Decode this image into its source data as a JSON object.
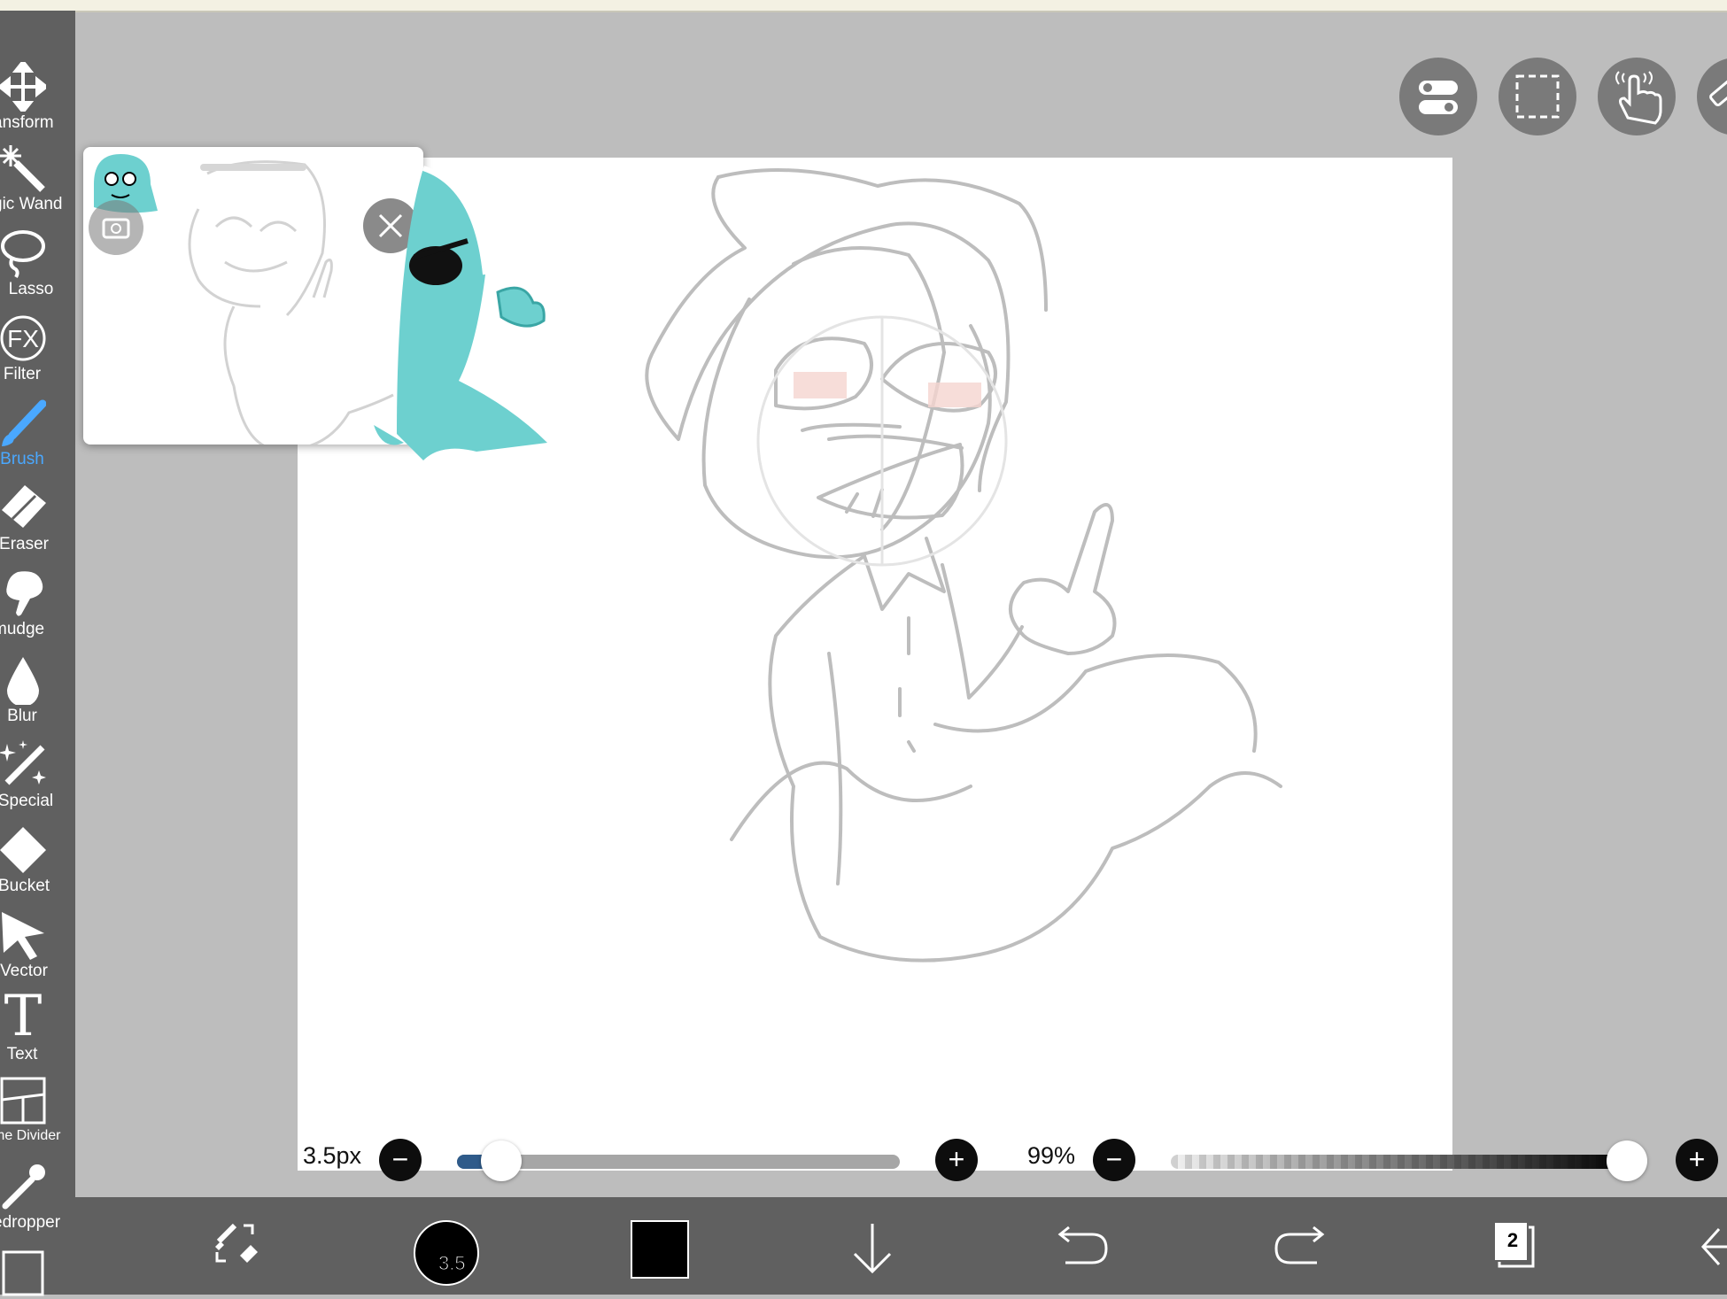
{
  "toolbar": {
    "tools": [
      {
        "label": "ansform",
        "icon": "transform-icon"
      },
      {
        "label": "gic Wand",
        "icon": "magic-wand-icon"
      },
      {
        "label": "Lasso",
        "icon": "lasso-icon"
      },
      {
        "label": "Filter",
        "icon": "filter-fx-icon",
        "fx": "FX"
      },
      {
        "label": "Brush",
        "icon": "brush-icon",
        "active": true
      },
      {
        "label": "Eraser",
        "icon": "eraser-icon"
      },
      {
        "label": "mudge",
        "icon": "smudge-icon"
      },
      {
        "label": "Blur",
        "icon": "blur-drop-icon"
      },
      {
        "label": "Special",
        "icon": "special-pen-icon"
      },
      {
        "label": "Bucket",
        "icon": "bucket-icon"
      },
      {
        "label": "Vector",
        "icon": "vector-arrow-icon"
      },
      {
        "label": "Text",
        "icon": "text-icon",
        "glyph": "T"
      },
      {
        "label": "me Divider",
        "icon": "frame-divider-icon"
      },
      {
        "label": "edropper",
        "icon": "eyedropper-icon"
      }
    ]
  },
  "top_buttons": [
    {
      "name": "toggle-icon"
    },
    {
      "name": "selection-icon"
    },
    {
      "name": "gesture-hand-icon"
    },
    {
      "name": "ruler-icon"
    }
  ],
  "sliders": {
    "brush_size": {
      "label": "3.5px",
      "value_fraction": 0.03
    },
    "opacity": {
      "label": "99%",
      "value_fraction": 0.99
    }
  },
  "bottom_bar": {
    "brush_size_badge": "3.5",
    "color": "#000000",
    "layers_count": "2",
    "icons": [
      "brush-swap-icon",
      "brush-size-icon",
      "color-swatch-icon",
      "download-arrow-icon",
      "undo-icon",
      "redo-icon",
      "layers-icon",
      "back-icon"
    ]
  },
  "colors": {
    "accent": "#4aa8ff",
    "toolbar": "#606060",
    "canvas_bg": "#bdbdbd",
    "character_teal": "#6dd0cf"
  }
}
